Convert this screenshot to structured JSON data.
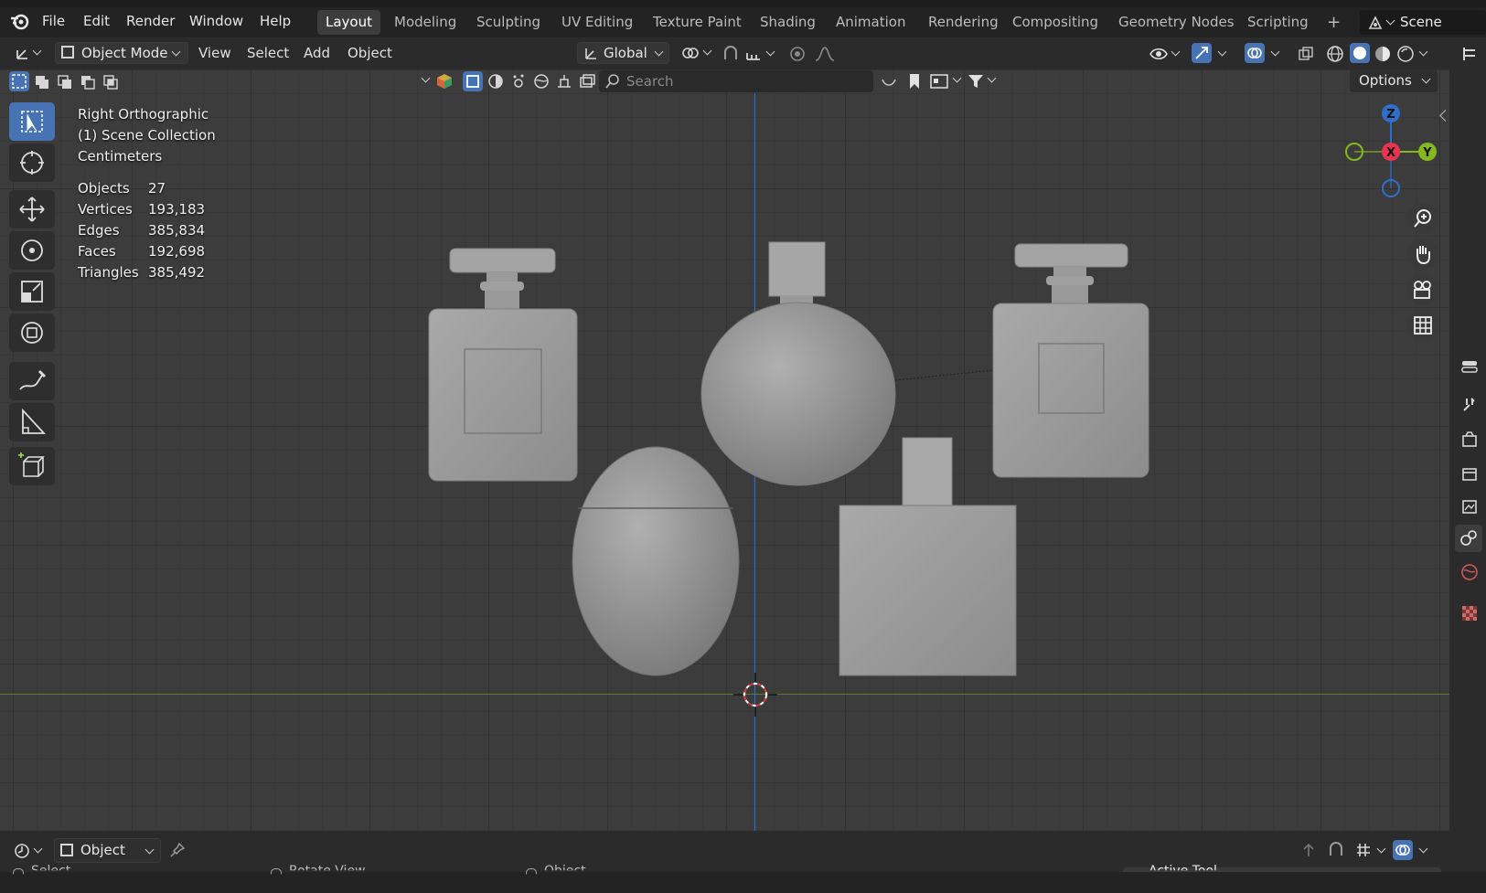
{
  "app": {
    "menus": [
      "File",
      "Edit",
      "Render",
      "Window",
      "Help"
    ],
    "workspaces": [
      "Layout",
      "Modeling",
      "Sculpting",
      "UV Editing",
      "Texture Paint",
      "Shading",
      "Animation",
      "Rendering",
      "Compositing",
      "Geometry Nodes",
      "Scripting"
    ],
    "active_workspace": "Layout",
    "add_workspace": "+",
    "scene_label": "Scene"
  },
  "header": {
    "mode": "Object Mode",
    "view": "View",
    "select": "Select",
    "add": "Add",
    "object": "Object",
    "transform_orientation": "Global",
    "search_placeholder": "Search",
    "options": "Options"
  },
  "viewport": {
    "view_name": "Right Orthographic",
    "collection": "(1) Scene Collection",
    "units": "Centimeters",
    "stats": [
      {
        "label": "Objects",
        "value": "27"
      },
      {
        "label": "Vertices",
        "value": "193,183"
      },
      {
        "label": "Edges",
        "value": "385,834"
      },
      {
        "label": "Faces",
        "value": "192,698"
      },
      {
        "label": "Triangles",
        "value": "385,492"
      }
    ],
    "gizmo": {
      "z": "Z",
      "x": "X",
      "y": "Y"
    },
    "colors": {
      "accent": "#4772b3",
      "x_axis": "#e8344f",
      "y_axis": "#84b81f",
      "z_axis": "#2f6ec9",
      "horizon": "#5f7a2a"
    }
  },
  "bottom": {
    "mode": "Object",
    "panel": "Active Tool"
  },
  "status": {
    "hints": [
      "Select",
      "Rotate View",
      "Object"
    ]
  }
}
